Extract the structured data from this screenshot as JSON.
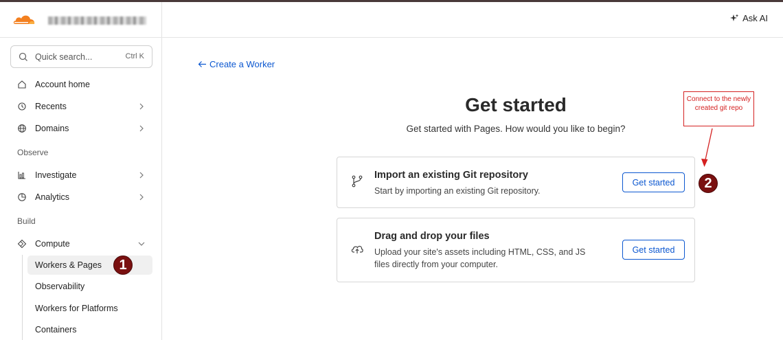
{
  "sidebar": {
    "search": {
      "placeholder": "Quick search...",
      "shortcut": "Ctrl K"
    },
    "nav_primary": [
      {
        "label": "Account home",
        "icon": "home-icon"
      },
      {
        "label": "Recents",
        "icon": "history-icon"
      },
      {
        "label": "Domains",
        "icon": "globe-icon"
      }
    ],
    "section_observe": "Observe",
    "nav_observe": [
      {
        "label": "Investigate",
        "icon": "investigate-icon"
      },
      {
        "label": "Analytics",
        "icon": "analytics-icon"
      }
    ],
    "section_build": "Build",
    "compute": {
      "label": "Compute",
      "icon": "compute-icon"
    },
    "compute_items": [
      {
        "label": "Workers & Pages"
      },
      {
        "label": "Observability"
      },
      {
        "label": "Workers for Platforms"
      },
      {
        "label": "Containers"
      }
    ]
  },
  "header": {
    "ask_ai": "Ask AI"
  },
  "main": {
    "back_link": "Create a Worker",
    "title": "Get started",
    "subtitle": "Get started with Pages. How would you like to begin?",
    "cards": [
      {
        "title": "Import an existing Git repository",
        "description": "Start by importing an existing Git repository.",
        "button": "Get started",
        "icon": "git-branch-icon"
      },
      {
        "title": "Drag and drop your files",
        "description": "Upload your site's assets including HTML, CSS, and JS files directly from your computer.",
        "button": "Get started",
        "icon": "upload-cloud-icon"
      }
    ]
  },
  "annotations": {
    "badge_1": "1",
    "badge_2": "2",
    "note": "Connect to the newly created git repo",
    "color": "#d42020",
    "badge_color": "#7a1010"
  },
  "colors": {
    "accent": "#0b57d0",
    "brand": "#f38020"
  }
}
